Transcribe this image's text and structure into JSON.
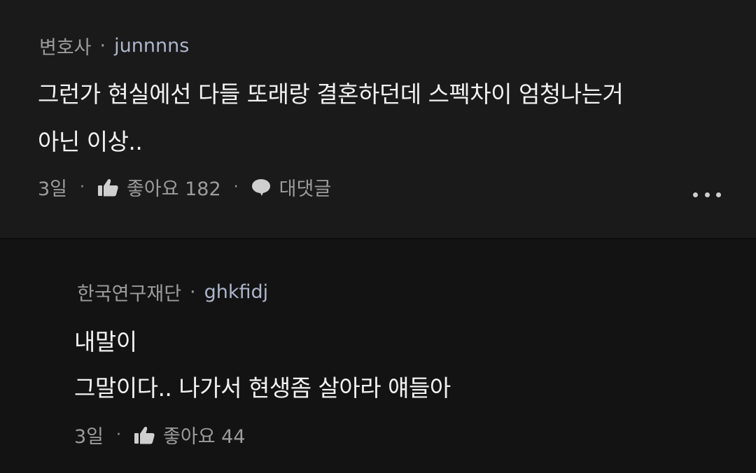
{
  "comments": [
    {
      "author": "변호사",
      "handle": "junnnns",
      "lines": [
        "그런가 현실에선 다들 또래랑 결혼하던데 스펙차이 엄청나는거",
        "아닌 이상.."
      ],
      "time": "3일",
      "likes_label": "좋아요 182",
      "reply_label": "대댓글",
      "more_icon": "more-horizontal-icon"
    },
    {
      "author": "한국연구재단",
      "handle": "ghkfidj",
      "lines": [
        "내말이",
        "그말이다.. 나가서 현생좀 살아라 얘들아"
      ],
      "time": "3일",
      "likes_label": "좋아요 44"
    }
  ],
  "separator": "·",
  "icons": {
    "like": "thumbs-up-icon",
    "reply": "speech-bubble-icon"
  },
  "colors": {
    "background_main": "#1a1a1a",
    "background_reply": "#131313",
    "text_primary": "#f2f2f2",
    "text_secondary": "#9c9c9c",
    "handle": "#aeb6cc"
  }
}
